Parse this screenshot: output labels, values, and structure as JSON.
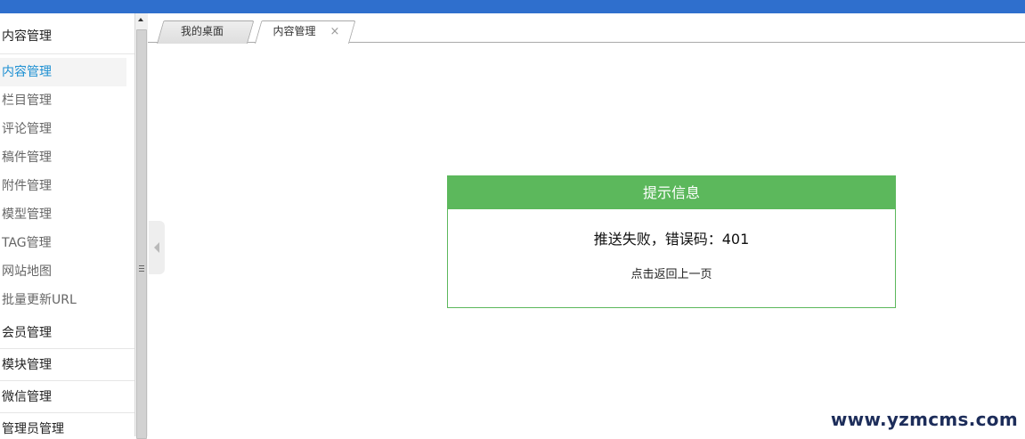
{
  "colors": {
    "topbar": "#2f6fcd",
    "active_item": "#1c8fd2",
    "message_header": "#5cb85c",
    "watermark": "#1d2d5a"
  },
  "sidebar": {
    "groups": [
      {
        "title": "内容管理",
        "items": [
          {
            "label": "内容管理",
            "active": true
          },
          {
            "label": "栏目管理"
          },
          {
            "label": "评论管理"
          },
          {
            "label": "稿件管理"
          },
          {
            "label": "附件管理"
          },
          {
            "label": "模型管理"
          },
          {
            "label": "TAG管理"
          },
          {
            "label": "网站地图"
          },
          {
            "label": "批量更新URL"
          }
        ]
      },
      {
        "title": "会员管理"
      },
      {
        "title": "模块管理"
      },
      {
        "title": "微信管理"
      },
      {
        "title": "管理员管理"
      }
    ]
  },
  "tabs": [
    {
      "label": "我的桌面",
      "active": false
    },
    {
      "label": "内容管理",
      "active": true,
      "close_icon": "close-icon",
      "close_symbol": "×"
    }
  ],
  "message_box": {
    "title": "提示信息",
    "message": "推送失败，错误码：401",
    "back_link": "点击返回上一页"
  },
  "watermark": "www.yzmcms.com"
}
